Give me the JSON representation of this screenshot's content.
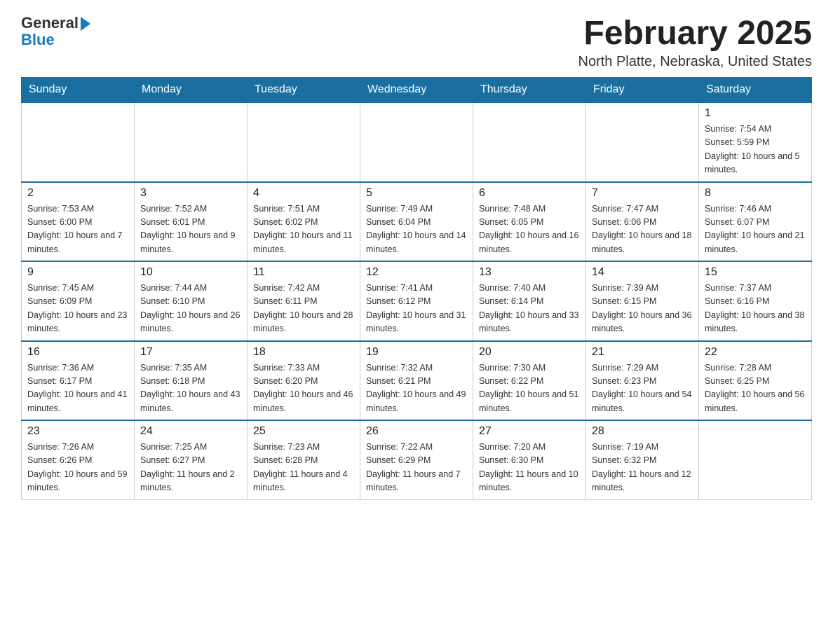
{
  "header": {
    "logo_general": "General",
    "logo_blue": "Blue",
    "month_title": "February 2025",
    "location": "North Platte, Nebraska, United States"
  },
  "days_of_week": [
    "Sunday",
    "Monday",
    "Tuesday",
    "Wednesday",
    "Thursday",
    "Friday",
    "Saturday"
  ],
  "weeks": [
    [
      {
        "day": "",
        "info": ""
      },
      {
        "day": "",
        "info": ""
      },
      {
        "day": "",
        "info": ""
      },
      {
        "day": "",
        "info": ""
      },
      {
        "day": "",
        "info": ""
      },
      {
        "day": "",
        "info": ""
      },
      {
        "day": "1",
        "info": "Sunrise: 7:54 AM\nSunset: 5:59 PM\nDaylight: 10 hours and 5 minutes."
      }
    ],
    [
      {
        "day": "2",
        "info": "Sunrise: 7:53 AM\nSunset: 6:00 PM\nDaylight: 10 hours and 7 minutes."
      },
      {
        "day": "3",
        "info": "Sunrise: 7:52 AM\nSunset: 6:01 PM\nDaylight: 10 hours and 9 minutes."
      },
      {
        "day": "4",
        "info": "Sunrise: 7:51 AM\nSunset: 6:02 PM\nDaylight: 10 hours and 11 minutes."
      },
      {
        "day": "5",
        "info": "Sunrise: 7:49 AM\nSunset: 6:04 PM\nDaylight: 10 hours and 14 minutes."
      },
      {
        "day": "6",
        "info": "Sunrise: 7:48 AM\nSunset: 6:05 PM\nDaylight: 10 hours and 16 minutes."
      },
      {
        "day": "7",
        "info": "Sunrise: 7:47 AM\nSunset: 6:06 PM\nDaylight: 10 hours and 18 minutes."
      },
      {
        "day": "8",
        "info": "Sunrise: 7:46 AM\nSunset: 6:07 PM\nDaylight: 10 hours and 21 minutes."
      }
    ],
    [
      {
        "day": "9",
        "info": "Sunrise: 7:45 AM\nSunset: 6:09 PM\nDaylight: 10 hours and 23 minutes."
      },
      {
        "day": "10",
        "info": "Sunrise: 7:44 AM\nSunset: 6:10 PM\nDaylight: 10 hours and 26 minutes."
      },
      {
        "day": "11",
        "info": "Sunrise: 7:42 AM\nSunset: 6:11 PM\nDaylight: 10 hours and 28 minutes."
      },
      {
        "day": "12",
        "info": "Sunrise: 7:41 AM\nSunset: 6:12 PM\nDaylight: 10 hours and 31 minutes."
      },
      {
        "day": "13",
        "info": "Sunrise: 7:40 AM\nSunset: 6:14 PM\nDaylight: 10 hours and 33 minutes."
      },
      {
        "day": "14",
        "info": "Sunrise: 7:39 AM\nSunset: 6:15 PM\nDaylight: 10 hours and 36 minutes."
      },
      {
        "day": "15",
        "info": "Sunrise: 7:37 AM\nSunset: 6:16 PM\nDaylight: 10 hours and 38 minutes."
      }
    ],
    [
      {
        "day": "16",
        "info": "Sunrise: 7:36 AM\nSunset: 6:17 PM\nDaylight: 10 hours and 41 minutes."
      },
      {
        "day": "17",
        "info": "Sunrise: 7:35 AM\nSunset: 6:18 PM\nDaylight: 10 hours and 43 minutes."
      },
      {
        "day": "18",
        "info": "Sunrise: 7:33 AM\nSunset: 6:20 PM\nDaylight: 10 hours and 46 minutes."
      },
      {
        "day": "19",
        "info": "Sunrise: 7:32 AM\nSunset: 6:21 PM\nDaylight: 10 hours and 49 minutes."
      },
      {
        "day": "20",
        "info": "Sunrise: 7:30 AM\nSunset: 6:22 PM\nDaylight: 10 hours and 51 minutes."
      },
      {
        "day": "21",
        "info": "Sunrise: 7:29 AM\nSunset: 6:23 PM\nDaylight: 10 hours and 54 minutes."
      },
      {
        "day": "22",
        "info": "Sunrise: 7:28 AM\nSunset: 6:25 PM\nDaylight: 10 hours and 56 minutes."
      }
    ],
    [
      {
        "day": "23",
        "info": "Sunrise: 7:26 AM\nSunset: 6:26 PM\nDaylight: 10 hours and 59 minutes."
      },
      {
        "day": "24",
        "info": "Sunrise: 7:25 AM\nSunset: 6:27 PM\nDaylight: 11 hours and 2 minutes."
      },
      {
        "day": "25",
        "info": "Sunrise: 7:23 AM\nSunset: 6:28 PM\nDaylight: 11 hours and 4 minutes."
      },
      {
        "day": "26",
        "info": "Sunrise: 7:22 AM\nSunset: 6:29 PM\nDaylight: 11 hours and 7 minutes."
      },
      {
        "day": "27",
        "info": "Sunrise: 7:20 AM\nSunset: 6:30 PM\nDaylight: 11 hours and 10 minutes."
      },
      {
        "day": "28",
        "info": "Sunrise: 7:19 AM\nSunset: 6:32 PM\nDaylight: 11 hours and 12 minutes."
      },
      {
        "day": "",
        "info": ""
      }
    ]
  ]
}
